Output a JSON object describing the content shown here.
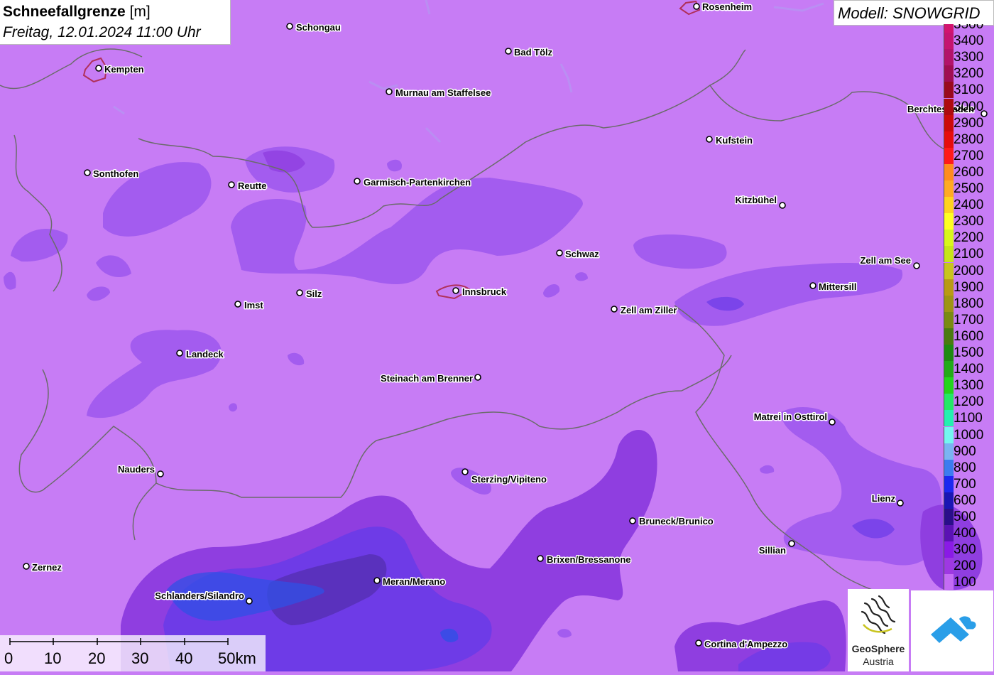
{
  "title": {
    "parameter": "Schneefallgrenze",
    "unit": "[m]",
    "valid_time": "Freitag, 12.01.2024 11:00 Uhr"
  },
  "model": {
    "label": "Modell: SNOWGRID"
  },
  "colors": {
    "base_fill": "#c77cf5",
    "violet": "#a35cef",
    "purple": "#8f3ee0",
    "indigo": "#6a3be8",
    "dark": "#4a2a9a",
    "blue": "#3050e6",
    "border": "#6b6b6b",
    "innsbruck_outline": "#b0305a"
  },
  "legend": {
    "entries": [
      {
        "value": "3500",
        "color": "#d2146e"
      },
      {
        "value": "3400",
        "color": "#c51470"
      },
      {
        "value": "3300",
        "color": "#b3136a"
      },
      {
        "value": "3200",
        "color": "#a00e52"
      },
      {
        "value": "3100",
        "color": "#9a0a1e"
      },
      {
        "value": "3000",
        "color": "#ae0a10"
      },
      {
        "value": "2900",
        "color": "#cc0a0a"
      },
      {
        "value": "2800",
        "color": "#e60d0d"
      },
      {
        "value": "2700",
        "color": "#ff1a1a"
      },
      {
        "value": "2600",
        "color": "#ff8c1e"
      },
      {
        "value": "2500",
        "color": "#ffaa22"
      },
      {
        "value": "2400",
        "color": "#ffd21e"
      },
      {
        "value": "2300",
        "color": "#ffff22"
      },
      {
        "value": "2200",
        "color": "#d8f71c"
      },
      {
        "value": "2100",
        "color": "#c6e619"
      },
      {
        "value": "2000",
        "color": "#c8c41e"
      },
      {
        "value": "1900",
        "color": "#b99a16"
      },
      {
        "value": "1800",
        "color": "#9e9416"
      },
      {
        "value": "1700",
        "color": "#7a8a12"
      },
      {
        "value": "1600",
        "color": "#4a7a10"
      },
      {
        "value": "1500",
        "color": "#1e8a12"
      },
      {
        "value": "1400",
        "color": "#22aa18"
      },
      {
        "value": "1300",
        "color": "#22d41c"
      },
      {
        "value": "1200",
        "color": "#22e866"
      },
      {
        "value": "1100",
        "color": "#22f0b0"
      },
      {
        "value": "1000",
        "color": "#74f6f0"
      },
      {
        "value": "900",
        "color": "#7ab4f2"
      },
      {
        "value": "800",
        "color": "#3c7cf0"
      },
      {
        "value": "700",
        "color": "#1c28f0"
      },
      {
        "value": "600",
        "color": "#1a16b4"
      },
      {
        "value": "500",
        "color": "#2a0e8a"
      },
      {
        "value": "400",
        "color": "#5a12b4"
      },
      {
        "value": "300",
        "color": "#8a1ae6"
      },
      {
        "value": "200",
        "color": "#9e38e2"
      },
      {
        "value": "100",
        "color": "#c46cf4"
      }
    ]
  },
  "cities": [
    {
      "name": "Rosenheim",
      "dot": [
        981,
        9
      ],
      "label": [
        989,
        14
      ],
      "anchor": "start"
    },
    {
      "name": "Schongau",
      "dot": [
        408,
        37
      ],
      "label": [
        417,
        43
      ],
      "anchor": "start"
    },
    {
      "name": "Bad Tölz",
      "dot": [
        716,
        72
      ],
      "label": [
        724,
        78
      ],
      "anchor": "start"
    },
    {
      "name": "Kempten",
      "dot": [
        139,
        96
      ],
      "label": [
        147,
        102
      ],
      "anchor": "start"
    },
    {
      "name": "Murnau am Staffelsee",
      "dot": [
        548,
        129
      ],
      "label": [
        557,
        135
      ],
      "anchor": "start"
    },
    {
      "name": "Berchtesgaden",
      "dot": [
        1386,
        160
      ],
      "label": [
        1278,
        158
      ],
      "anchor": "start"
    },
    {
      "name": "Kufstein",
      "dot": [
        999,
        196
      ],
      "label": [
        1008,
        202
      ],
      "anchor": "start"
    },
    {
      "name": "Sonthofen",
      "dot": [
        123,
        243
      ],
      "label": [
        131,
        249
      ],
      "anchor": "start"
    },
    {
      "name": "Garmisch-Partenkirchen",
      "dot": [
        503,
        255
      ],
      "label": [
        512,
        261
      ],
      "anchor": "start"
    },
    {
      "name": "Reutte",
      "dot": [
        326,
        260
      ],
      "label": [
        335,
        266
      ],
      "anchor": "start"
    },
    {
      "name": "Kitzbühel",
      "dot": [
        1102,
        289
      ],
      "label": [
        1094,
        286
      ],
      "anchor": "end"
    },
    {
      "name": "Schwaz",
      "dot": [
        788,
        356
      ],
      "label": [
        796,
        362
      ],
      "anchor": "start"
    },
    {
      "name": "Zell am See",
      "dot": [
        1291,
        374
      ],
      "label": [
        1283,
        371
      ],
      "anchor": "end"
    },
    {
      "name": "Mittersill",
      "dot": [
        1145,
        402
      ],
      "label": [
        1153,
        408
      ],
      "anchor": "start"
    },
    {
      "name": "Innsbruck",
      "dot": [
        642,
        409
      ],
      "label": [
        651,
        415
      ],
      "anchor": "start"
    },
    {
      "name": "Silz",
      "dot": [
        422,
        412
      ],
      "label": [
        431,
        418
      ],
      "anchor": "start"
    },
    {
      "name": "Imst",
      "dot": [
        335,
        428
      ],
      "label": [
        344,
        434
      ],
      "anchor": "start"
    },
    {
      "name": "Zell am Ziller",
      "dot": [
        865,
        435
      ],
      "label": [
        874,
        441
      ],
      "anchor": "start"
    },
    {
      "name": "Landeck",
      "dot": [
        253,
        497
      ],
      "label": [
        262,
        503
      ],
      "anchor": "start"
    },
    {
      "name": "Steinach am Brenner",
      "dot": [
        673,
        531
      ],
      "label": [
        666,
        537
      ],
      "anchor": "end"
    },
    {
      "name": "Matrei in Osttirol",
      "dot": [
        1172,
        594
      ],
      "label": [
        1165,
        591
      ],
      "anchor": "end"
    },
    {
      "name": "Nauders",
      "dot": [
        226,
        667
      ],
      "label": [
        218,
        665
      ],
      "anchor": "end"
    },
    {
      "name": "Sterzing/Vipiteno",
      "dot": [
        655,
        664
      ],
      "label": [
        664,
        679
      ],
      "anchor": "start"
    },
    {
      "name": "Lienz",
      "dot": [
        1268,
        708
      ],
      "label": [
        1261,
        706
      ],
      "anchor": "end"
    },
    {
      "name": "Bruneck/Brunico",
      "dot": [
        891,
        733
      ],
      "label": [
        900,
        738
      ],
      "anchor": "start"
    },
    {
      "name": "Sillian",
      "dot": [
        1115,
        765
      ],
      "label": [
        1107,
        779
      ],
      "anchor": "end"
    },
    {
      "name": "Brixen/Bressanone",
      "dot": [
        761,
        786
      ],
      "label": [
        770,
        792
      ],
      "anchor": "start"
    },
    {
      "name": "Zernez",
      "dot": [
        37,
        797
      ],
      "label": [
        45,
        803
      ],
      "anchor": "start"
    },
    {
      "name": "Meran/Merano",
      "dot": [
        531,
        817
      ],
      "label": [
        539,
        823
      ],
      "anchor": "start"
    },
    {
      "name": "Schlanders/Silandro",
      "dot": [
        351,
        846
      ],
      "label": [
        344,
        843
      ],
      "anchor": "end"
    },
    {
      "name": "Cortina d'Ampezzo",
      "dot": [
        984,
        905
      ],
      "label": [
        992,
        911
      ],
      "anchor": "start"
    }
  ],
  "scalebar": {
    "ticks": [
      "0",
      "10",
      "20",
      "30",
      "40",
      "50km"
    ]
  },
  "logos": {
    "geosphere_line1": "GeoSphere",
    "geosphere_line2": "Austria"
  }
}
